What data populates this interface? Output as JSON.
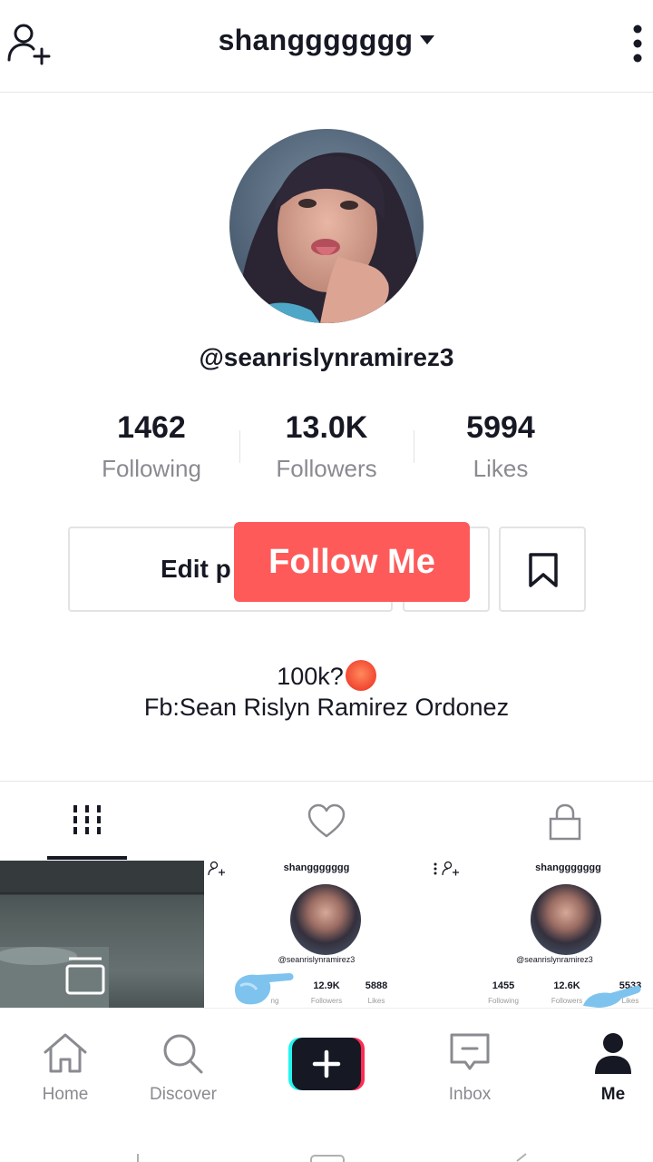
{
  "header": {
    "title": "shanggggggg"
  },
  "profile": {
    "username": "@seanrislynramirez3",
    "stats": [
      {
        "value": "1462",
        "label": "Following"
      },
      {
        "value": "13.0K",
        "label": "Followers"
      },
      {
        "value": "5994",
        "label": "Likes"
      }
    ],
    "edit_button": "Edit p",
    "follow_overlay": "Follow Me",
    "bio_line1": "100k?",
    "bio_line2": "Fb:Sean Rislyn Ramirez Ordonez"
  },
  "grid": {
    "cell2": {
      "title": "shanggggggg",
      "username": "@seanrislynramirez3",
      "stats": [
        {
          "value": "",
          "label": "ng"
        },
        {
          "value": "12.9K",
          "label": "Followers"
        },
        {
          "value": "5888",
          "label": "Likes"
        }
      ]
    },
    "cell3": {
      "title": "shanggggggg",
      "username": "@seanrislynramirez3",
      "stats": [
        {
          "value": "1455",
          "label": "Following"
        },
        {
          "value": "12.6K",
          "label": "Followers"
        },
        {
          "value": "5533",
          "label": "Likes"
        }
      ]
    }
  },
  "nav": {
    "items": [
      {
        "label": "Home",
        "icon": "home-icon"
      },
      {
        "label": "Discover",
        "icon": "search-icon"
      },
      {
        "label": "",
        "icon": "plus-icon"
      },
      {
        "label": "Inbox",
        "icon": "inbox-icon"
      },
      {
        "label": "Me",
        "icon": "person-icon"
      }
    ]
  },
  "colors": {
    "follow_overlay": "#fe5a5a",
    "text": "#161823",
    "muted": "#8a8b91"
  }
}
